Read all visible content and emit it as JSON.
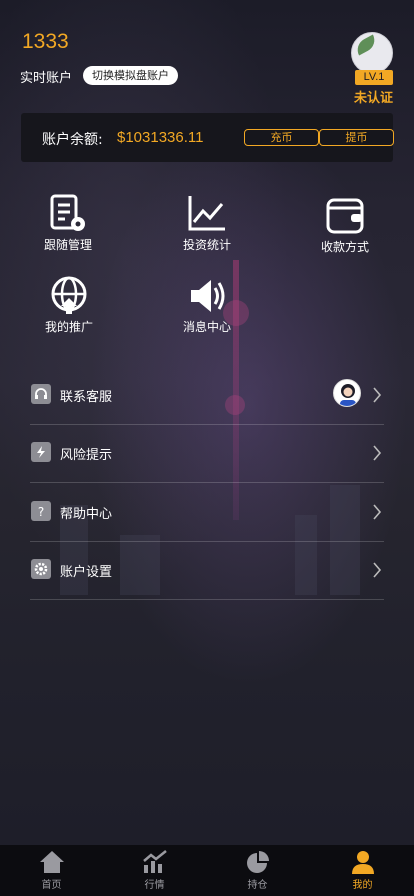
{
  "header": {
    "user_id": "1333",
    "account_label": "实时账户",
    "switch_label": "切换模拟盘账户",
    "level": "LV.1",
    "verify_status": "未认证"
  },
  "balance": {
    "label": "账户余额:",
    "value": "$1031336.11",
    "recharge_label": "充币",
    "withdraw_label": "提币"
  },
  "grid": {
    "items": [
      {
        "label": "跟随管理",
        "icon": "document-gear-icon"
      },
      {
        "label": "投资统计",
        "icon": "line-chart-icon"
      },
      {
        "label": "收款方式",
        "icon": "wallet-icon"
      },
      {
        "label": "我的推广",
        "icon": "globe-upload-icon"
      },
      {
        "label": "消息中心",
        "icon": "speaker-icon"
      }
    ]
  },
  "menu": {
    "items": [
      {
        "label": "联系客服",
        "icon": "headset-icon"
      },
      {
        "label": "风险提示",
        "icon": "lightning-icon"
      },
      {
        "label": "帮助中心",
        "icon": "question-icon"
      },
      {
        "label": "账户设置",
        "icon": "gear-icon"
      }
    ]
  },
  "tabbar": {
    "items": [
      {
        "label": "首页",
        "icon": "home-icon"
      },
      {
        "label": "行情",
        "icon": "chart-icon"
      },
      {
        "label": "持仓",
        "icon": "pie-icon"
      },
      {
        "label": "我的",
        "icon": "user-icon"
      }
    ],
    "active": "我的"
  },
  "colors": {
    "accent": "#f2a824",
    "card_bg": "#16161c",
    "tabbar_bg": "#0c0c10"
  }
}
